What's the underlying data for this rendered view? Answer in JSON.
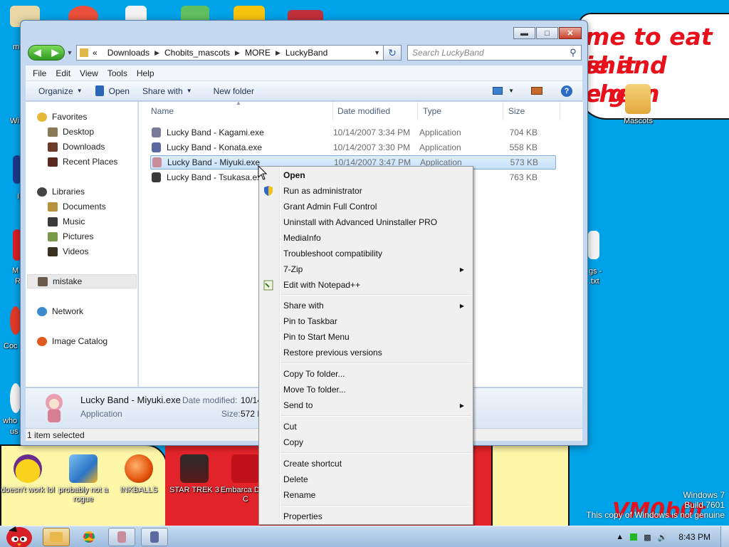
{
  "desktop": {
    "wallpaper_lines": [
      "me to eat shit",
      "ie and chew",
      "e gun"
    ],
    "watermark": "VM0b0t",
    "icons_bottom": [
      {
        "label": "doesn't work lol"
      },
      {
        "label": "probably not a rogue"
      },
      {
        "label": "INKBALLS"
      },
      {
        "label": "STAR TREK 3"
      },
      {
        "label": "Embarca Dev-C"
      }
    ],
    "mascots_label": "Mascots",
    "edge_labels": {
      "wi": "Wi",
      "m1": "m",
      "m2": "M",
      "r": "R",
      "coc": "Coc",
      "who": "who",
      "us": "us",
      "gs": "gs -",
      "txt": ".txt",
      "i": "I"
    },
    "windows_info": [
      "Windows 7",
      "Build 7601",
      "This copy of Windows is not genuine"
    ]
  },
  "window": {
    "breadcrumb": [
      "Downloads",
      "Chobits_mascots",
      "MORE",
      "LuckyBand"
    ],
    "breadcrumb_prefix": "«",
    "search_placeholder": "Search LuckyBand",
    "menubar": [
      "File",
      "Edit",
      "View",
      "Tools",
      "Help"
    ],
    "toolbar": {
      "organize": "Organize",
      "open": "Open",
      "share_with": "Share with",
      "new_folder": "New folder"
    },
    "nav": {
      "favorites": "Favorites",
      "desktop": "Desktop",
      "downloads": "Downloads",
      "recent": "Recent Places",
      "libraries": "Libraries",
      "documents": "Documents",
      "music": "Music",
      "pictures": "Pictures",
      "videos": "Videos",
      "mistake": "mistake",
      "network": "Network",
      "image_catalog": "Image Catalog"
    },
    "columns": {
      "name": "Name",
      "date": "Date modified",
      "type": "Type",
      "size": "Size"
    },
    "files": [
      {
        "name": "Lucky Band - Kagami.exe",
        "date": "10/14/2007 3:34 PM",
        "type": "Application",
        "size": "704 KB"
      },
      {
        "name": "Lucky Band - Konata.exe",
        "date": "10/14/2007 3:30 PM",
        "type": "Application",
        "size": "558 KB"
      },
      {
        "name": "Lucky Band - Miyuki.exe",
        "date": "10/14/2007 3:47 PM",
        "type": "Application",
        "size": "573 KB"
      },
      {
        "name": "Lucky Band - Tsukasa.exe",
        "date": "",
        "type": "",
        "size": "763 KB"
      }
    ],
    "details": {
      "name": "Lucky Band - Miyuki.exe",
      "type": "Application",
      "date_label": "Date modified:",
      "date_value": "10/14",
      "size_label": "Size:",
      "size_value": "572 K"
    },
    "status": "1 item selected"
  },
  "context_menu": {
    "items": [
      "Open",
      "Run as administrator",
      "Grant Admin Full Control",
      "Uninstall with Advanced Uninstaller PRO",
      "MediaInfo",
      "Troubleshoot compatibility",
      "7-Zip",
      "Edit with Notepad++",
      "Share with",
      "Pin to Taskbar",
      "Pin to Start Menu",
      "Restore previous versions",
      "Copy To folder...",
      "Move To folder...",
      "Send to",
      "Cut",
      "Copy",
      "Create shortcut",
      "Delete",
      "Rename",
      "Properties"
    ]
  },
  "taskbar": {
    "clock": "8:43 PM"
  }
}
